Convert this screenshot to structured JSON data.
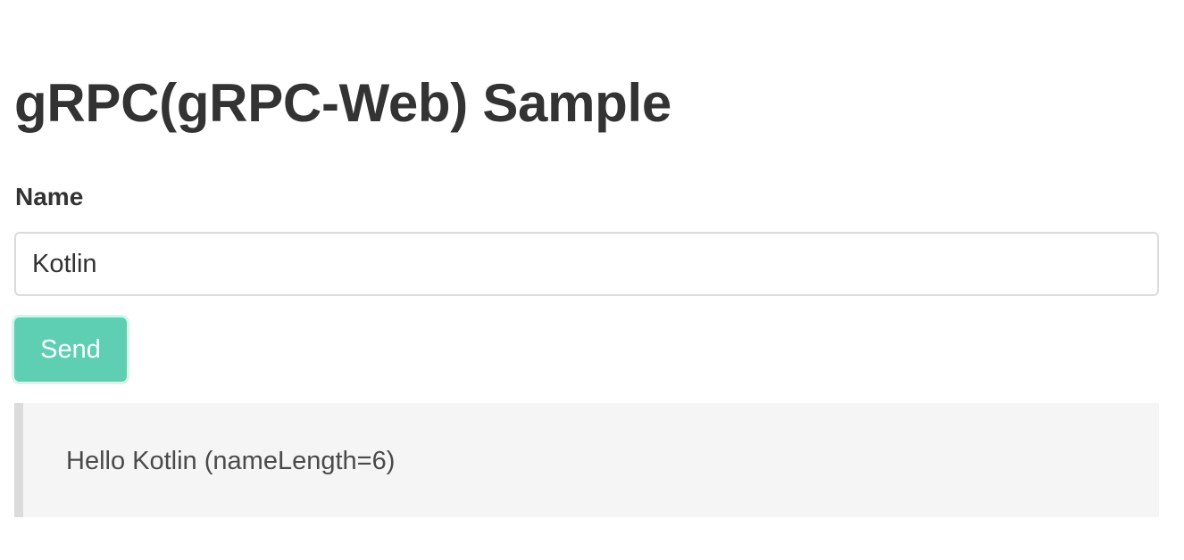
{
  "page": {
    "title": "gRPC(gRPC-Web) Sample"
  },
  "form": {
    "name_label": "Name",
    "name_value": "Kotlin",
    "send_label": "Send"
  },
  "result": {
    "message": "Hello Kotlin (nameLength=6)"
  },
  "colors": {
    "button_accent": "#5ecfb3",
    "result_background": "#f5f5f5",
    "result_border": "#dbdbdb"
  }
}
